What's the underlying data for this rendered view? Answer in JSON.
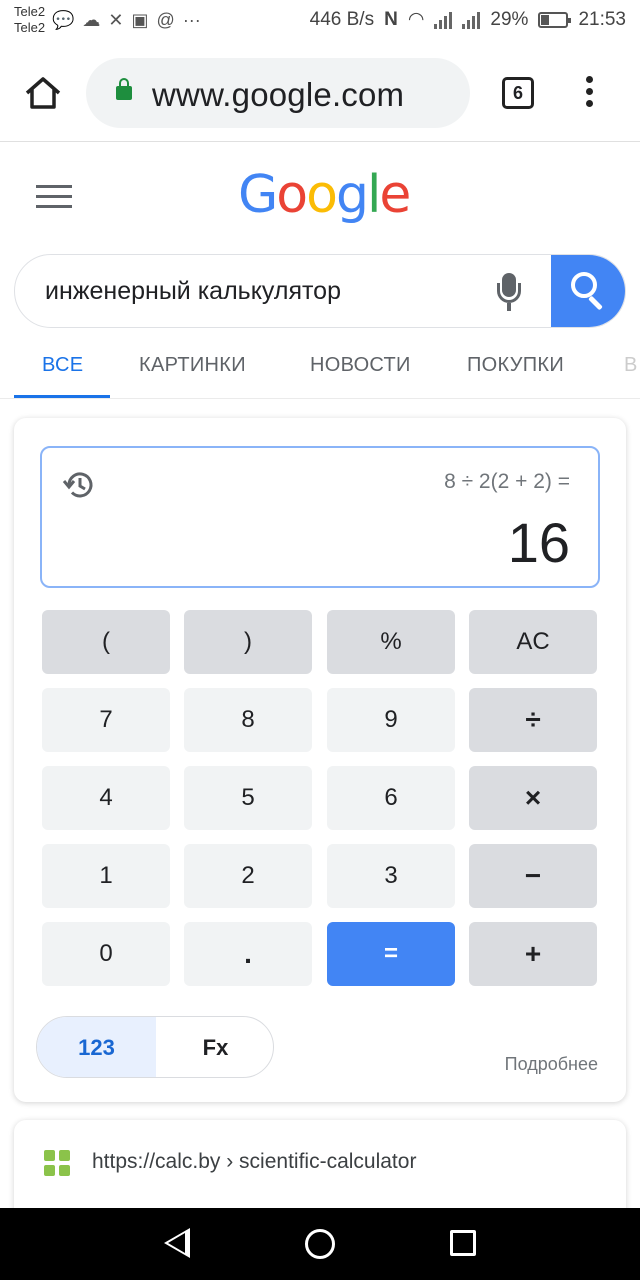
{
  "status_bar": {
    "carrier_1": "Tele2",
    "carrier_2": "Tele2",
    "more_notifications": "···",
    "speed": "446 B/s",
    "battery": "29%",
    "time": "21:53"
  },
  "browser": {
    "url": "www.google.com",
    "tab_count": "6"
  },
  "google": {
    "logo_letters": [
      "G",
      "o",
      "o",
      "g",
      "l",
      "e"
    ],
    "logo_colors": [
      "#4285f4",
      "#ea4335",
      "#fbbc05",
      "#4285f4",
      "#34a853",
      "#ea4335"
    ]
  },
  "search": {
    "query": "инженерный калькулятор"
  },
  "tabs": [
    {
      "label": "ВСЕ",
      "active": true
    },
    {
      "label": "КАРТИНКИ",
      "active": false
    },
    {
      "label": "НОВОСТИ",
      "active": false
    },
    {
      "label": "ПОКУПКИ",
      "active": false
    },
    {
      "label": "В",
      "active": false
    }
  ],
  "calculator": {
    "expression": "8 ÷ 2(2 + 2) =",
    "result": "16",
    "keys": [
      [
        "(",
        ")",
        "%",
        "AC"
      ],
      [
        "7",
        "8",
        "9",
        "÷"
      ],
      [
        "4",
        "5",
        "6",
        "×"
      ],
      [
        "1",
        "2",
        "3",
        "−"
      ],
      [
        "0",
        ".",
        "=",
        "+"
      ]
    ],
    "mode_numeric": "123",
    "mode_functions": "Fx",
    "more_link": "Подробнее"
  },
  "result": {
    "url": "https://calc.by › scientific-calculator"
  }
}
